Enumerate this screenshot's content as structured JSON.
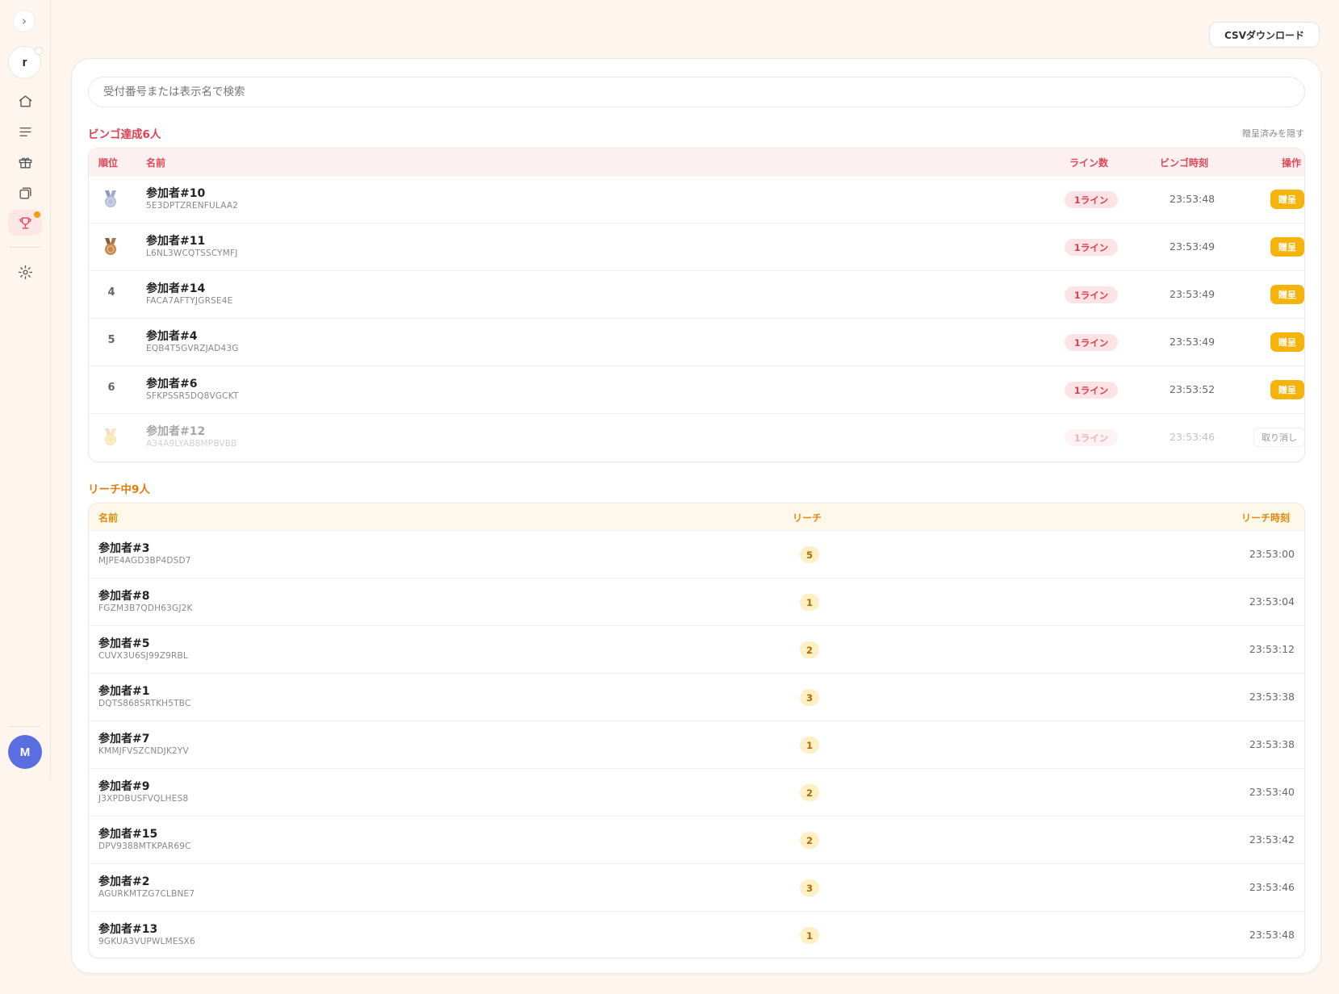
{
  "sidebar": {
    "toggle_glyph": "›",
    "workspace_initial": "r",
    "user_initial": "M",
    "icons": [
      "home-icon",
      "list-icon",
      "gift-icon",
      "copy-icon",
      "trophy-icon",
      "gear-icon"
    ]
  },
  "toolbar": {
    "csv_label": "CSVダウンロード"
  },
  "search": {
    "placeholder": "受付番号または表示名で検索"
  },
  "bingo": {
    "title": "ビンゴ達成6人",
    "hide_label": "贈呈済みを隠す",
    "headers": {
      "rank": "順位",
      "name": "名前",
      "lines": "ライン数",
      "time": "ビンゴ時刻",
      "action": "操作"
    },
    "rows": [
      {
        "rank": "2",
        "medal": "silver",
        "name": "参加者#10",
        "code": "5E3DPTZRENFULAA2",
        "lines": "1ライン",
        "time": "23:53:48",
        "action": "贈呈",
        "given": false
      },
      {
        "rank": "3",
        "medal": "bronze",
        "name": "参加者#11",
        "code": "L6NL3WCQTSSCYMFJ",
        "lines": "1ライン",
        "time": "23:53:49",
        "action": "贈呈",
        "given": false
      },
      {
        "rank": "4",
        "medal": "",
        "name": "参加者#14",
        "code": "FACA7AFTYJGRSE4E",
        "lines": "1ライン",
        "time": "23:53:49",
        "action": "贈呈",
        "given": false
      },
      {
        "rank": "5",
        "medal": "",
        "name": "参加者#4",
        "code": "EQB4T5GVRZJAD43G",
        "lines": "1ライン",
        "time": "23:53:49",
        "action": "贈呈",
        "given": false
      },
      {
        "rank": "6",
        "medal": "",
        "name": "参加者#6",
        "code": "SFKPSSR5DQ8VGCKT",
        "lines": "1ライン",
        "time": "23:53:52",
        "action": "贈呈",
        "given": false
      },
      {
        "rank": "1",
        "medal": "gold",
        "name": "参加者#12",
        "code": "A34A9LYAB8MPBVBB",
        "lines": "1ライン",
        "time": "23:53:46",
        "action": "取り消し",
        "given": true
      }
    ]
  },
  "reach": {
    "title": "リーチ中9人",
    "headers": {
      "name": "名前",
      "reach": "リーチ",
      "time": "リーチ時刻"
    },
    "rows": [
      {
        "name": "参加者#3",
        "code": "MJPE4AGD3BP4DSD7",
        "reach": "5",
        "time": "23:53:00"
      },
      {
        "name": "参加者#8",
        "code": "FGZM3B7QDH63GJ2K",
        "reach": "1",
        "time": "23:53:04"
      },
      {
        "name": "参加者#5",
        "code": "CUVX3U6SJ99Z9RBL",
        "reach": "2",
        "time": "23:53:12"
      },
      {
        "name": "参加者#1",
        "code": "DQTS868SRTKH5TBC",
        "reach": "3",
        "time": "23:53:38"
      },
      {
        "name": "参加者#7",
        "code": "KMMJFVSZCNDJK2YV",
        "reach": "1",
        "time": "23:53:38"
      },
      {
        "name": "参加者#9",
        "code": "J3XPDBUSFVQLHES8",
        "reach": "2",
        "time": "23:53:40"
      },
      {
        "name": "参加者#15",
        "code": "DPV9388MTKPAR69C",
        "reach": "2",
        "time": "23:53:42"
      },
      {
        "name": "参加者#2",
        "code": "AGURKMTZG7CLBNE7",
        "reach": "3",
        "time": "23:53:46"
      },
      {
        "name": "参加者#13",
        "code": "9GKUA3VUPWLMESX6",
        "reach": "1",
        "time": "23:53:48"
      }
    ]
  },
  "colors": {
    "accent_red": "#e03e4e",
    "accent_orange": "#e07b0c",
    "gift_button": "#f5b30c",
    "user_avatar": "#5b6ee1"
  }
}
